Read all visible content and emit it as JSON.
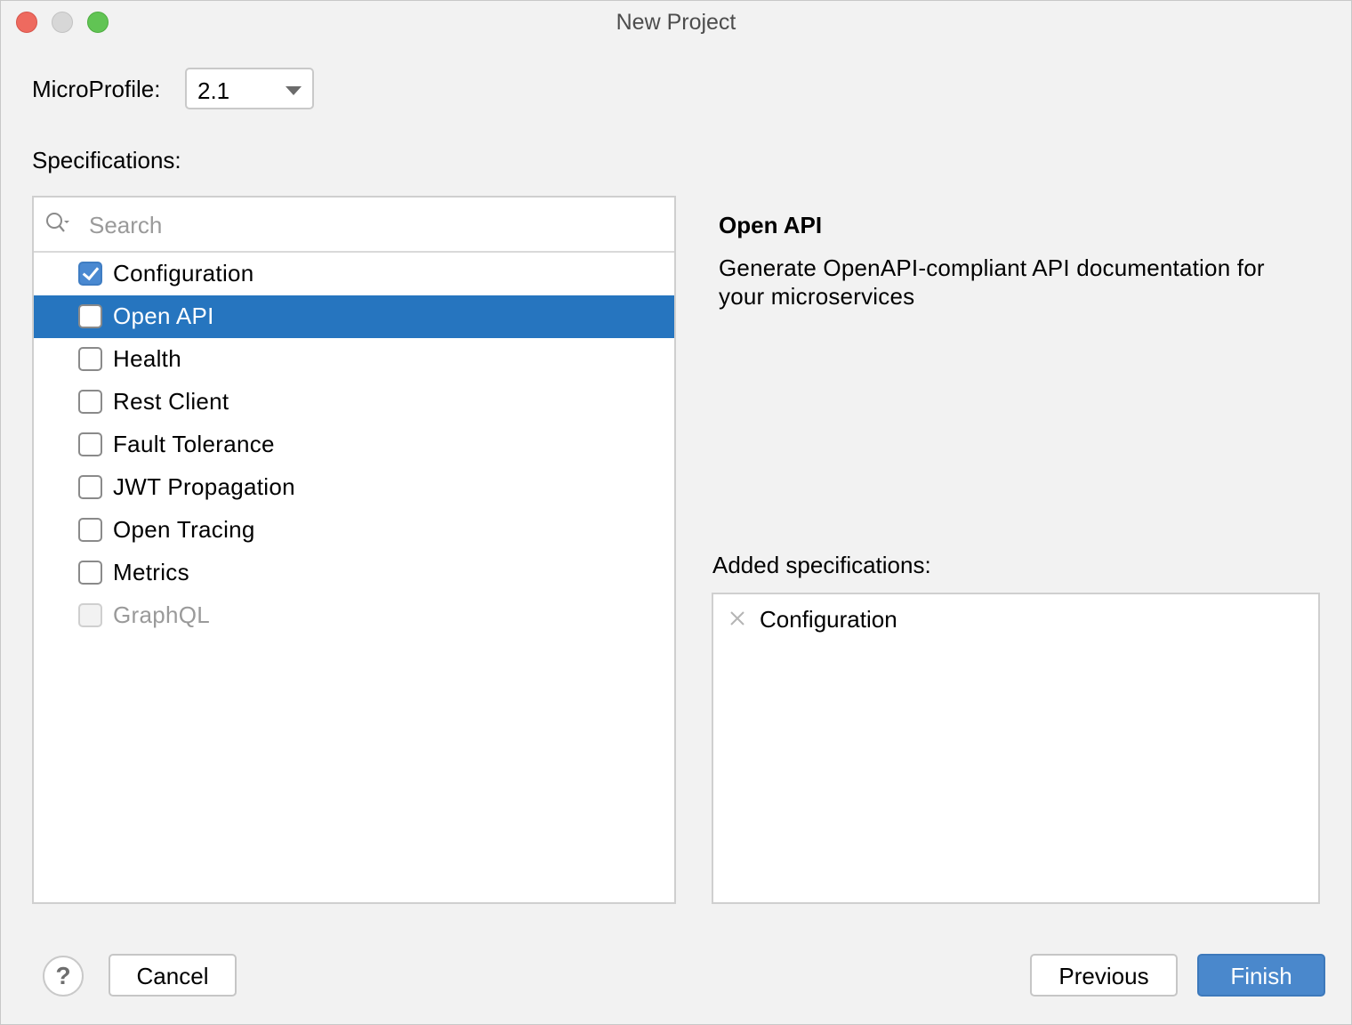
{
  "window": {
    "title": "New Project",
    "controls": [
      "close",
      "minimize",
      "maximize"
    ]
  },
  "microprofile": {
    "label": "MicroProfile:",
    "selected": "2.1"
  },
  "specifications": {
    "label": "Specifications:",
    "search_placeholder": "Search",
    "search_value": "",
    "items": [
      {
        "label": "Configuration",
        "checked": true,
        "selected": false,
        "disabled": false
      },
      {
        "label": "Open API",
        "checked": false,
        "selected": true,
        "disabled": false
      },
      {
        "label": "Health",
        "checked": false,
        "selected": false,
        "disabled": false
      },
      {
        "label": "Rest Client",
        "checked": false,
        "selected": false,
        "disabled": false
      },
      {
        "label": "Fault Tolerance",
        "checked": false,
        "selected": false,
        "disabled": false
      },
      {
        "label": "JWT Propagation",
        "checked": false,
        "selected": false,
        "disabled": false
      },
      {
        "label": "Open Tracing",
        "checked": false,
        "selected": false,
        "disabled": false
      },
      {
        "label": "Metrics",
        "checked": false,
        "selected": false,
        "disabled": false
      },
      {
        "label": "GraphQL",
        "checked": false,
        "selected": false,
        "disabled": true
      }
    ]
  },
  "description": {
    "title": "Open API",
    "text": "Generate OpenAPI-compliant API documentation for your microservices"
  },
  "added": {
    "label": "Added specifications:",
    "items": [
      {
        "label": "Configuration",
        "icon": "remove-icon"
      }
    ]
  },
  "footer": {
    "help_label": "?",
    "cancel_label": "Cancel",
    "previous_label": "Previous",
    "finish_label": "Finish"
  },
  "colors": {
    "selection": "#2675bf",
    "primary_button": "#4a88cc",
    "checkbox_checked": "#4a89d1"
  }
}
